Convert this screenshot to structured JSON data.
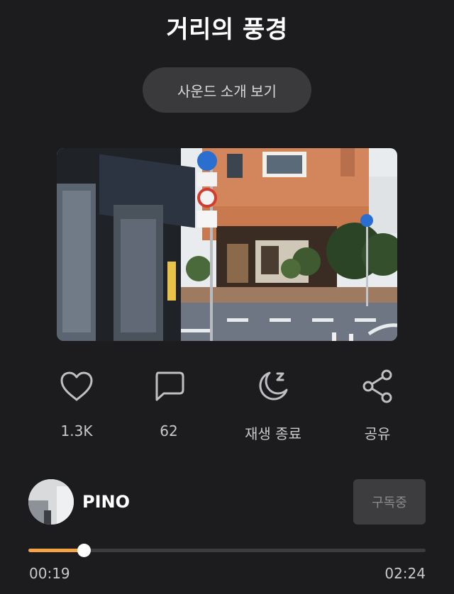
{
  "track": {
    "title": "거리의 풍경"
  },
  "intro_button": {
    "label": "사운드 소개 보기"
  },
  "actions": {
    "like": {
      "label": "1.3K",
      "icon": "heart-icon"
    },
    "comment": {
      "label": "62",
      "icon": "comment-icon"
    },
    "sleep_timer": {
      "label": "재생 종료",
      "icon": "moon-zzz-icon"
    },
    "share": {
      "label": "공유",
      "icon": "share-icon"
    }
  },
  "author": {
    "name": "PINO"
  },
  "subscribe_button": {
    "label": "구독중"
  },
  "playback": {
    "current_time": "00:19",
    "duration": "02:24",
    "progress_fraction": 0.1397
  },
  "colors": {
    "background": "#1c1b1e",
    "accent": "#f5a347"
  }
}
